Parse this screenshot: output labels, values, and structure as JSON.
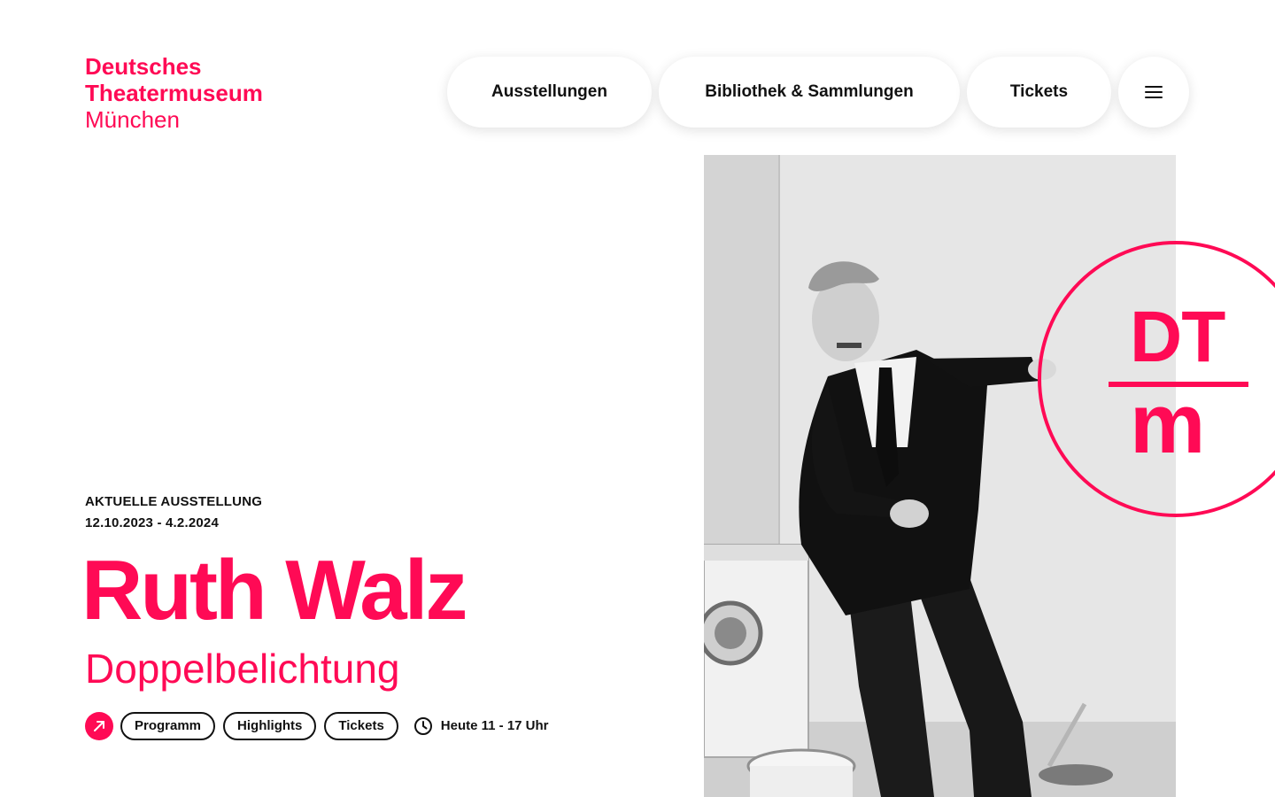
{
  "brand": {
    "line1": "Deutsches",
    "line2": "Theatermuseum",
    "line3": "München",
    "accent_color": "#ff0a55"
  },
  "nav": {
    "items": [
      {
        "label": "Ausstellungen"
      },
      {
        "label": "Bibliothek & Sammlungen"
      },
      {
        "label": "Tickets"
      }
    ],
    "menu_icon": "hamburger-menu-icon"
  },
  "hero": {
    "kicker": "AKTUELLE AUSSTELLUNG",
    "dates": "12.10.2023 - 4.2.2024",
    "title": "Ruth Walz",
    "subtitle": "Doppelbelichtung",
    "badge_top": "DT",
    "badge_bottom": "m",
    "image": "black-and-white photo of a man in a suit gesturing"
  },
  "actions": {
    "arrow_icon": "arrow-up-right-icon",
    "buttons": [
      {
        "label": "Programm"
      },
      {
        "label": "Highlights"
      },
      {
        "label": "Tickets"
      }
    ],
    "clock_icon": "clock-icon",
    "hours": "Heute 11 - 17 Uhr"
  }
}
